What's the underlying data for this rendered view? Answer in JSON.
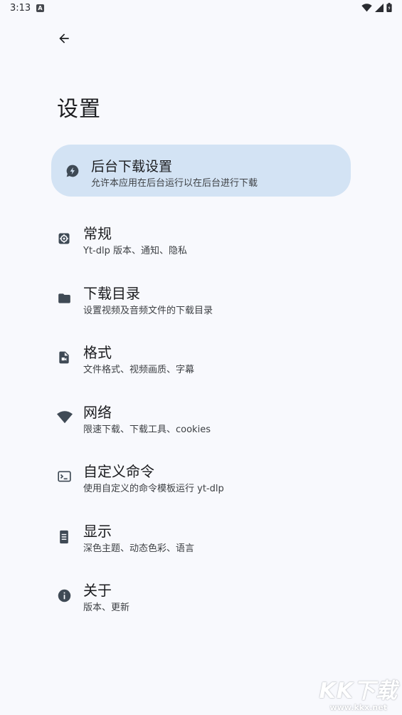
{
  "status_bar": {
    "time": "3:13",
    "app_badge": "A"
  },
  "page": {
    "title": "设置"
  },
  "items": [
    {
      "key": "background",
      "title": "后台下载设置",
      "subtitle": "允许本应用在后台运行以在后台进行下载",
      "icon": "bolt-bubble-icon",
      "highlighted": true
    },
    {
      "key": "general",
      "title": "常规",
      "subtitle": "Yt-dlp 版本、通知、隐私",
      "icon": "settings-gear-icon"
    },
    {
      "key": "download_dir",
      "title": "下载目录",
      "subtitle": "设置视频及音频文件的下载目录",
      "icon": "folder-icon"
    },
    {
      "key": "format",
      "title": "格式",
      "subtitle": "文件格式、视频画质、字幕",
      "icon": "video-file-icon"
    },
    {
      "key": "network",
      "title": "网络",
      "subtitle": "限速下载、下载工具、cookies",
      "icon": "wifi-icon"
    },
    {
      "key": "custom_command",
      "title": "自定义命令",
      "subtitle": "使用自定义的命令模板运行 yt-dlp",
      "icon": "terminal-icon"
    },
    {
      "key": "display",
      "title": "显示",
      "subtitle": "深色主题、动态色彩、语言",
      "icon": "phone-display-icon"
    },
    {
      "key": "about",
      "title": "关于",
      "subtitle": "版本、更新",
      "icon": "info-icon"
    }
  ],
  "watermark": {
    "logo": "KK下载",
    "url": "www.kkx.net"
  },
  "colors": {
    "background": "#f8f9fd",
    "highlight": "#d3e3f4",
    "icon": "#3f4a55"
  }
}
